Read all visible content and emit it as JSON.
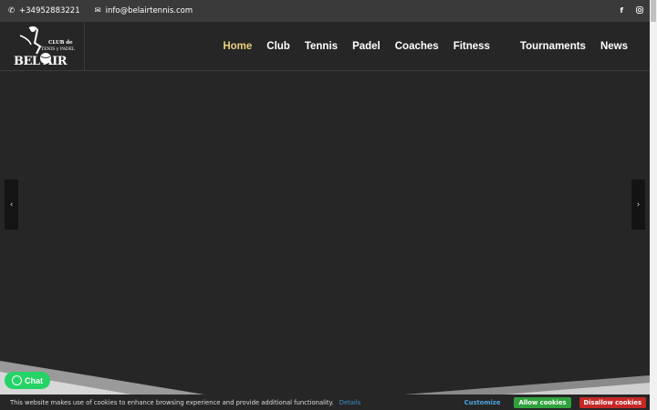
{
  "topbar": {
    "phone": "+34952883221",
    "email": "info@belairtennis.com",
    "social": [
      "facebook-icon",
      "instagram-icon"
    ]
  },
  "logo": {
    "line1": "CLUB de",
    "line2": "TENIS y PADEL",
    "brand": "BEL AIR"
  },
  "nav": {
    "items": [
      {
        "label": "Home",
        "active": true
      },
      {
        "label": "Club"
      },
      {
        "label": "Tennis"
      },
      {
        "label": "Padel"
      },
      {
        "label": "Coaches"
      },
      {
        "label": "Fitness"
      },
      {
        "label": "Tournaments"
      },
      {
        "label": "News"
      }
    ]
  },
  "slider": {
    "prev": "‹",
    "next": "›"
  },
  "chat": {
    "label": "Chat"
  },
  "cookie": {
    "message": "This website makes use of cookies to enhance browsing experience and provide additional functionality.",
    "details": "Details",
    "customize": "Customize",
    "allow": "Allow cookies",
    "disallow": "Disallow cookies"
  },
  "colors": {
    "accent": "#e9cf7c",
    "allow": "#30a23c",
    "disallow": "#c62828",
    "whatsapp": "#25d366"
  }
}
